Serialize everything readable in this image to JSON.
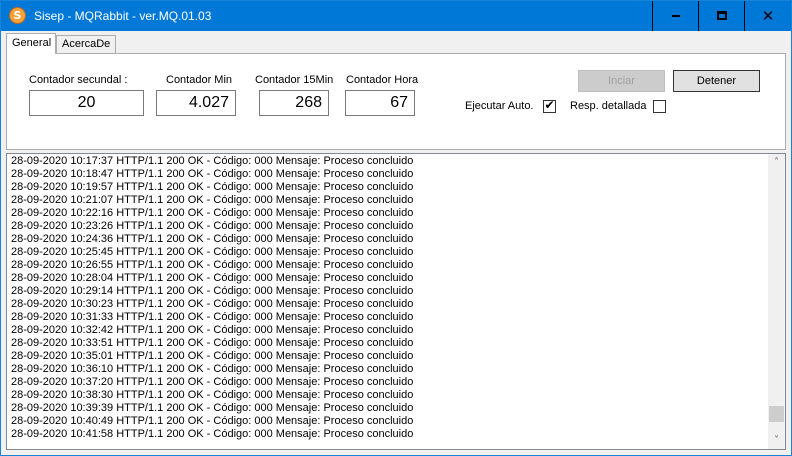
{
  "window": {
    "title": "Sisep - MQRabbit - ver.MQ.01.03",
    "icon_letter": "S",
    "controls": {
      "minimize": "minimize-icon",
      "maximize": "maximize-icon",
      "close": "✕"
    }
  },
  "tabs": [
    {
      "label": "General",
      "active": true
    },
    {
      "label": "AcercaDe",
      "active": false
    }
  ],
  "counters": {
    "segundal": {
      "label": "Contador secundal :",
      "value": "20"
    },
    "min": {
      "label": "Contador Min",
      "value": "4.027"
    },
    "min15": {
      "label": "Contador 15Min",
      "value": "268"
    },
    "hora": {
      "label": "Contador Hora",
      "value": "67"
    }
  },
  "buttons": {
    "iniciar": {
      "label": "Inciar",
      "enabled": false
    },
    "detener": {
      "label": "Detener",
      "enabled": true
    }
  },
  "options": {
    "ejecutar": {
      "label": "Ejecutar Auto.",
      "checked": true,
      "mark": "✔"
    },
    "resp": {
      "label": "Resp. detallada",
      "checked": false
    }
  },
  "log": {
    "lines": [
      "28-09-2020 10:17:37 HTTP/1.1 200 OK - Código: 000 Mensaje: Proceso concluido",
      "28-09-2020 10:18:47 HTTP/1.1 200 OK - Código: 000 Mensaje: Proceso concluido",
      "28-09-2020 10:19:57 HTTP/1.1 200 OK - Código: 000 Mensaje: Proceso concluido",
      "28-09-2020 10:21:07 HTTP/1.1 200 OK - Código: 000 Mensaje: Proceso concluido",
      "28-09-2020 10:22:16 HTTP/1.1 200 OK - Código: 000 Mensaje: Proceso concluido",
      "28-09-2020 10:23:26 HTTP/1.1 200 OK - Código: 000 Mensaje: Proceso concluido",
      "28-09-2020 10:24:36 HTTP/1.1 200 OK - Código: 000 Mensaje: Proceso concluido",
      "28-09-2020 10:25:45 HTTP/1.1 200 OK - Código: 000 Mensaje: Proceso concluido",
      "28-09-2020 10:26:55 HTTP/1.1 200 OK - Código: 000 Mensaje: Proceso concluido",
      "28-09-2020 10:28:04 HTTP/1.1 200 OK - Código: 000 Mensaje: Proceso concluido",
      "28-09-2020 10:29:14 HTTP/1.1 200 OK - Código: 000 Mensaje: Proceso concluido",
      "28-09-2020 10:30:23 HTTP/1.1 200 OK - Código: 000 Mensaje: Proceso concluido",
      "28-09-2020 10:31:33 HTTP/1.1 200 OK - Código: 000 Mensaje: Proceso concluido",
      "28-09-2020 10:32:42 HTTP/1.1 200 OK - Código: 000 Mensaje: Proceso concluido",
      "28-09-2020 10:33:51 HTTP/1.1 200 OK - Código: 000 Mensaje: Proceso concluido",
      "28-09-2020 10:35:01 HTTP/1.1 200 OK - Código: 000 Mensaje: Proceso concluido",
      "28-09-2020 10:36:10 HTTP/1.1 200 OK - Código: 000 Mensaje: Proceso concluido",
      "28-09-2020 10:37:20 HTTP/1.1 200 OK - Código: 000 Mensaje: Proceso concluido",
      "28-09-2020 10:38:30 HTTP/1.1 200 OK - Código: 000 Mensaje: Proceso concluido",
      "28-09-2020 10:39:39 HTTP/1.1 200 OK - Código: 000 Mensaje: Proceso concluido",
      "28-09-2020 10:40:49 HTTP/1.1 200 OK - Código: 000 Mensaje: Proceso concluido",
      "28-09-2020 10:41:58 HTTP/1.1 200 OK - Código: 000 Mensaje: Proceso concluido"
    ],
    "scroll_up_glyph": "˄",
    "scroll_down_glyph": "˅"
  },
  "colors": {
    "titlebar": "#0078d7",
    "window_bg": "#f0f0f0",
    "panel_bg": "#ffffff"
  }
}
